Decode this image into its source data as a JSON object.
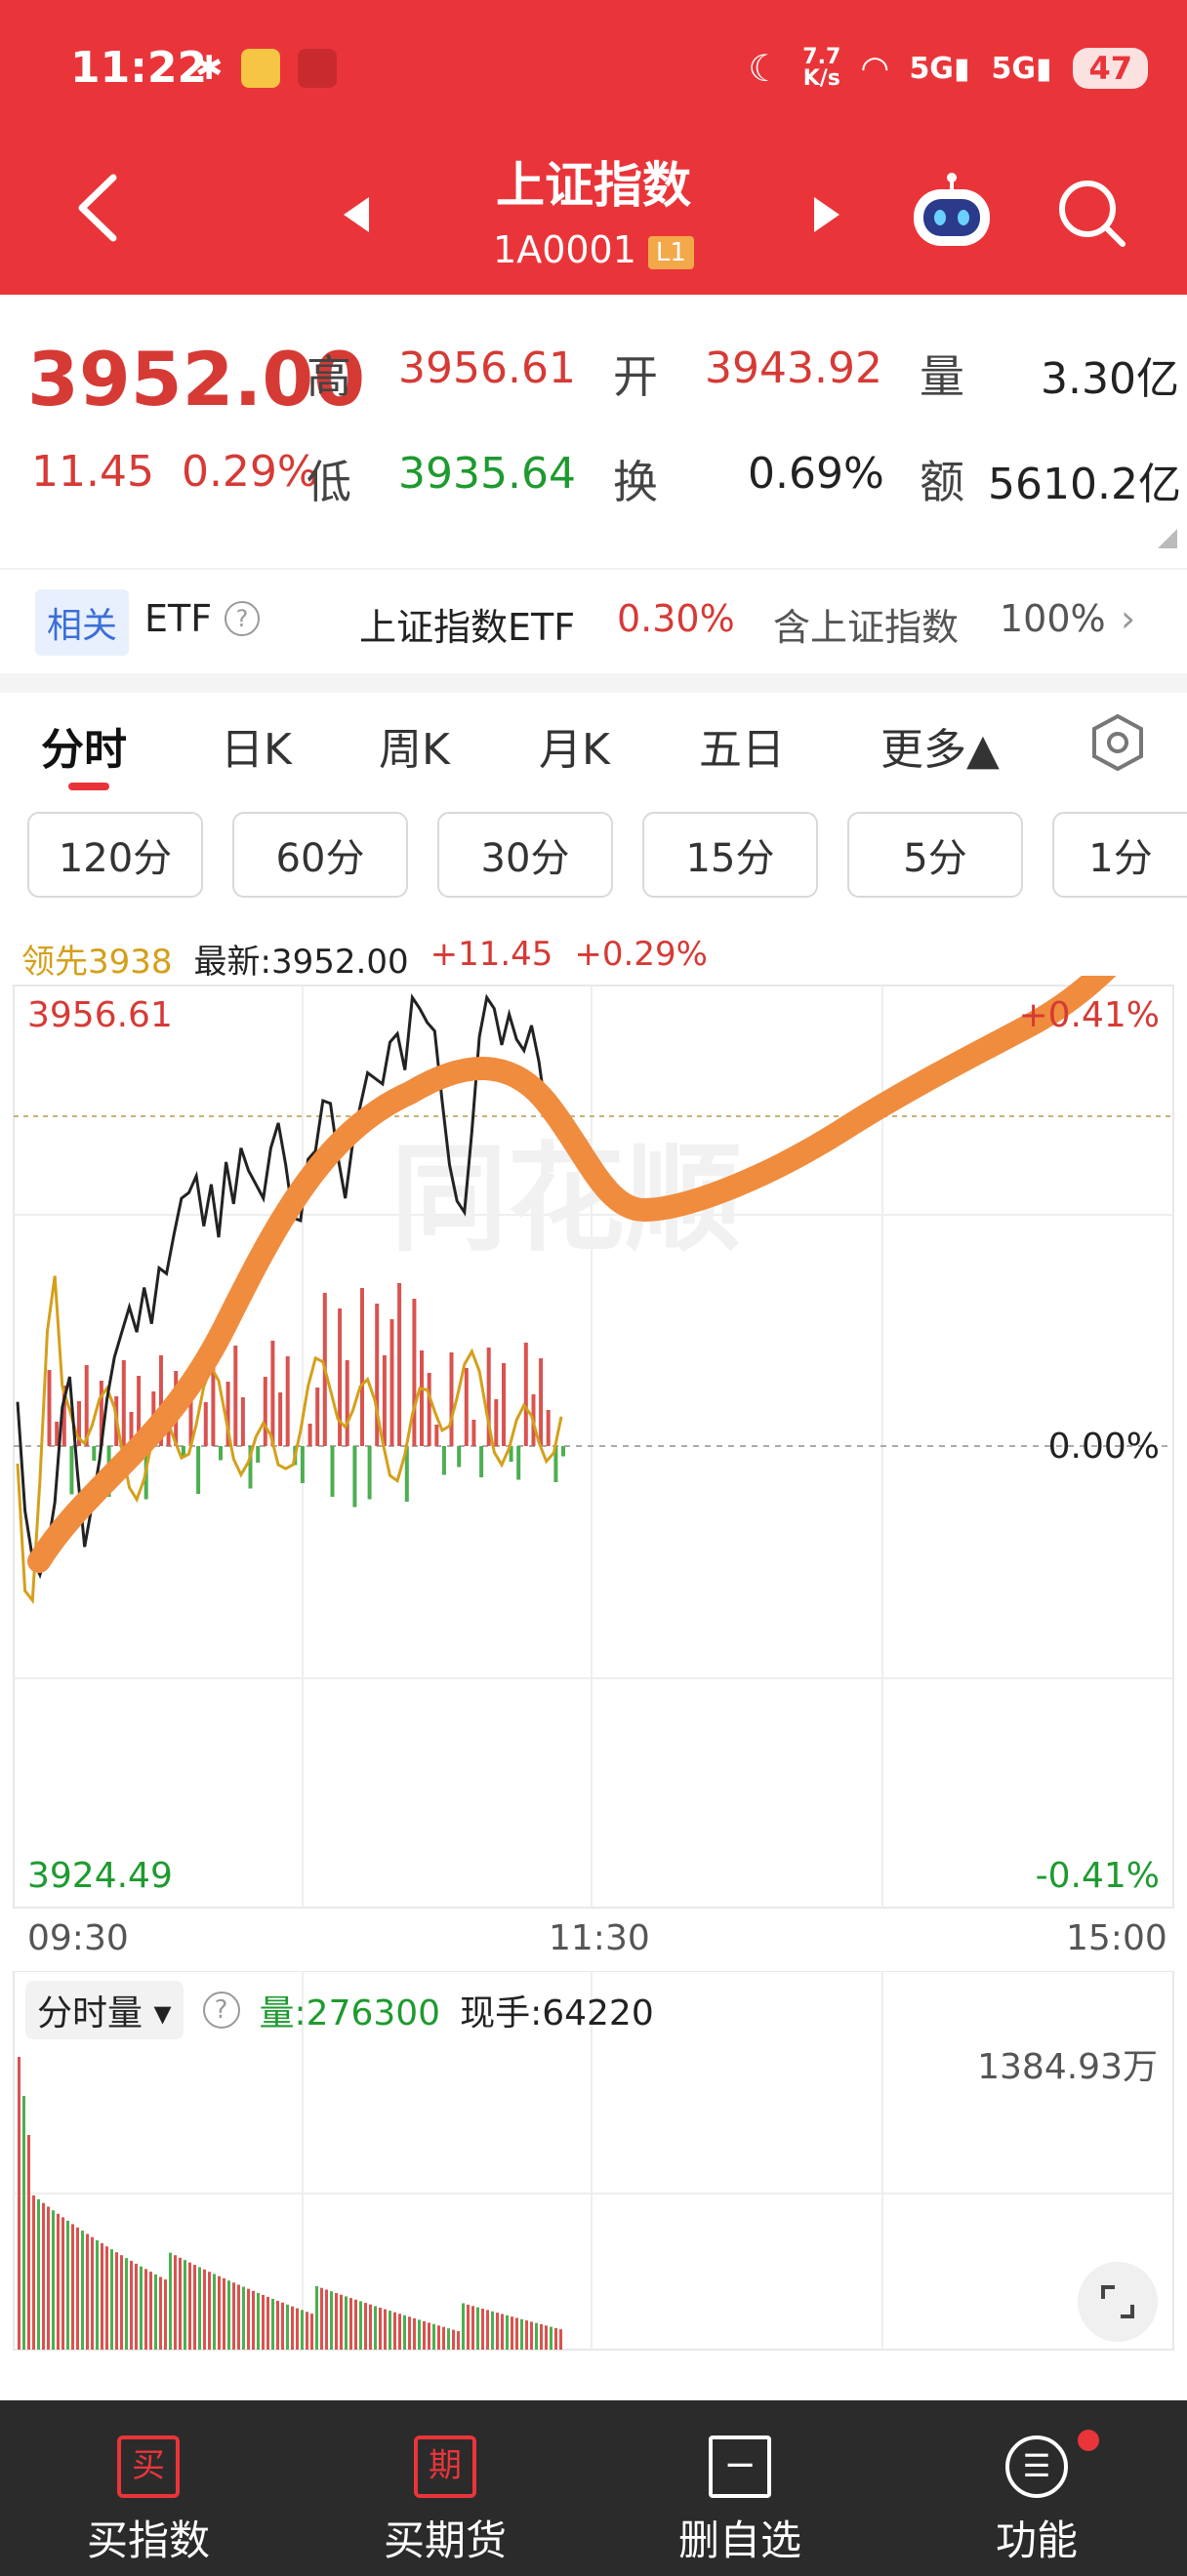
{
  "status_bar": {
    "time": "11:22",
    "net_speed_top": "7.7",
    "net_speed_bottom": "K/s",
    "sim1": "5G",
    "sim2": "5G",
    "battery": "47"
  },
  "header": {
    "title": "上证指数",
    "code": "1A0001",
    "level": "L1"
  },
  "quote": {
    "price": "3952.00",
    "change": "11.45",
    "change_pct": "0.29%",
    "high_label": "高",
    "high": "3956.61",
    "open_label": "开",
    "open": "3943.92",
    "volume_label": "量",
    "volume": "3.30亿",
    "low_label": "低",
    "low": "3935.64",
    "turnover_label": "换",
    "turnover": "0.69%",
    "amount_label": "额",
    "amount": "5610.2亿"
  },
  "etf": {
    "tag": "相关",
    "label": "ETF",
    "help": "?",
    "name": "上证指数ETF",
    "pct": "0.30%",
    "contains": "含上证指数",
    "weight": "100%"
  },
  "tabs": [
    {
      "label": "分时"
    },
    {
      "label": "日K"
    },
    {
      "label": "周K"
    },
    {
      "label": "月K"
    },
    {
      "label": "五日"
    },
    {
      "label": "更多▲"
    }
  ],
  "periods": [
    "120分",
    "60分",
    "30分",
    "15分",
    "5分",
    "1分"
  ],
  "info": {
    "leader": "领先3938",
    "latest": "最新:3952.00",
    "change": "+11.45",
    "change_pct": "+0.29%"
  },
  "chart_labels": {
    "top_price": "3956.61",
    "top_pct": "+0.41%",
    "zero_pct": "0.00%",
    "bottom_price": "3924.49",
    "bottom_pct": "-0.41%",
    "times": [
      "09:30",
      "11:30",
      "15:00"
    ],
    "watermark": "同花顺"
  },
  "volume_panel": {
    "selector": "分时量",
    "help": "?",
    "volume": "量:276300",
    "current": "现手:64220",
    "max": "1384.93万"
  },
  "bottom_nav": [
    {
      "label": "买指数",
      "icon": "买"
    },
    {
      "label": "买期货",
      "icon": "期"
    },
    {
      "label": "删自选",
      "icon": "−"
    },
    {
      "label": "功能",
      "icon": "☰"
    }
  ],
  "colors": {
    "header_red": "#e9353a",
    "up": "#d63a35",
    "down": "#1e9a2f",
    "leader": "#d4a01b",
    "annotation": "#f08c3e"
  },
  "chart_data": {
    "type": "line",
    "title": "",
    "xlabel": "",
    "ylabel": "",
    "prev_close": 3940.55,
    "ylim": [
      3924.49,
      3956.61
    ],
    "x_ticks": [
      "09:30",
      "11:30",
      "15:00"
    ],
    "series": [
      {
        "values": [
          3942.1,
          3938.2,
          3936.5,
          3935.9,
          3936.8,
          3938.5,
          3941.9,
          3943.0,
          3939.7,
          3936.9,
          3938.4,
          3940.0,
          3942.2,
          3943.7,
          3944.6,
          3945.5,
          3944.6,
          3946.2,
          3944.9,
          3946.9,
          3946.7,
          3948.1,
          3949.4,
          3949.6,
          3950.2,
          3948.4,
          3949.9,
          3948.0,
          3950.7,
          3949.2,
          3951.2,
          3950.4,
          3949.9,
          3949.4,
          3951.2,
          3952.1,
          3950.6,
          3948.7,
          3948.6,
          3950.8,
          3951.1,
          3952.9,
          3952.8,
          3950.9,
          3949.4,
          3951.4,
          3952.7,
          3953.9,
          3953.7,
          3953.5,
          3955.0,
          3955.3,
          3954.0,
          3956.6,
          3956.2,
          3955.7,
          3955.4,
          3952.9,
          3950.6,
          3949.3,
          3948.9,
          3951.8,
          3955.2,
          3956.6,
          3956.2,
          3954.9,
          3956.0,
          3955.1,
          3954.7,
          3955.6,
          3954.3,
          3952.4,
          3952.7,
          3952.0
        ]
      }
    ]
  }
}
